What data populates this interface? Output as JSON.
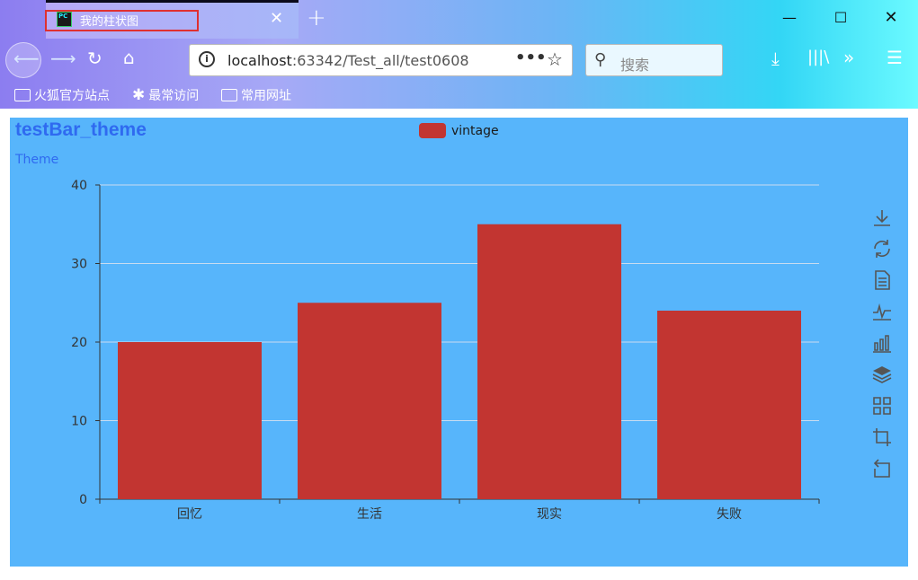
{
  "browser": {
    "tab_title": "我的柱状图",
    "tab_icon_label": "PC",
    "url_host": "localhost",
    "url_rest": ":63342/Test_all/test0608",
    "search_placeholder": "搜索",
    "bookmarks": [
      {
        "label": "火狐官方站点",
        "icon": "folder-icon"
      },
      {
        "label": "最常访问",
        "icon": "gear-icon"
      },
      {
        "label": "常用网址",
        "icon": "folder-icon"
      }
    ]
  },
  "page": {
    "title": "testBar_theme",
    "subtitle": "Theme",
    "accent_color": "#2f6af0",
    "background_color": "#57b5fb"
  },
  "chart_data": {
    "type": "bar",
    "categories": [
      "回忆",
      "生活",
      "现实",
      "失败"
    ],
    "series": [
      {
        "name": "vintage",
        "values": [
          20,
          25,
          35,
          24
        ],
        "color": "#c23531"
      }
    ],
    "ylim": [
      0,
      40
    ],
    "yticks": [
      0,
      10,
      20,
      30,
      40
    ],
    "grid": true,
    "legend_position": "top-center"
  },
  "toolbox": {
    "icons": [
      "download-icon",
      "refresh-icon",
      "data-view-icon",
      "line-chart-icon",
      "bar-chart-icon",
      "stack-icon",
      "tiled-icon",
      "zoom-icon",
      "zoom-reset-icon"
    ]
  }
}
